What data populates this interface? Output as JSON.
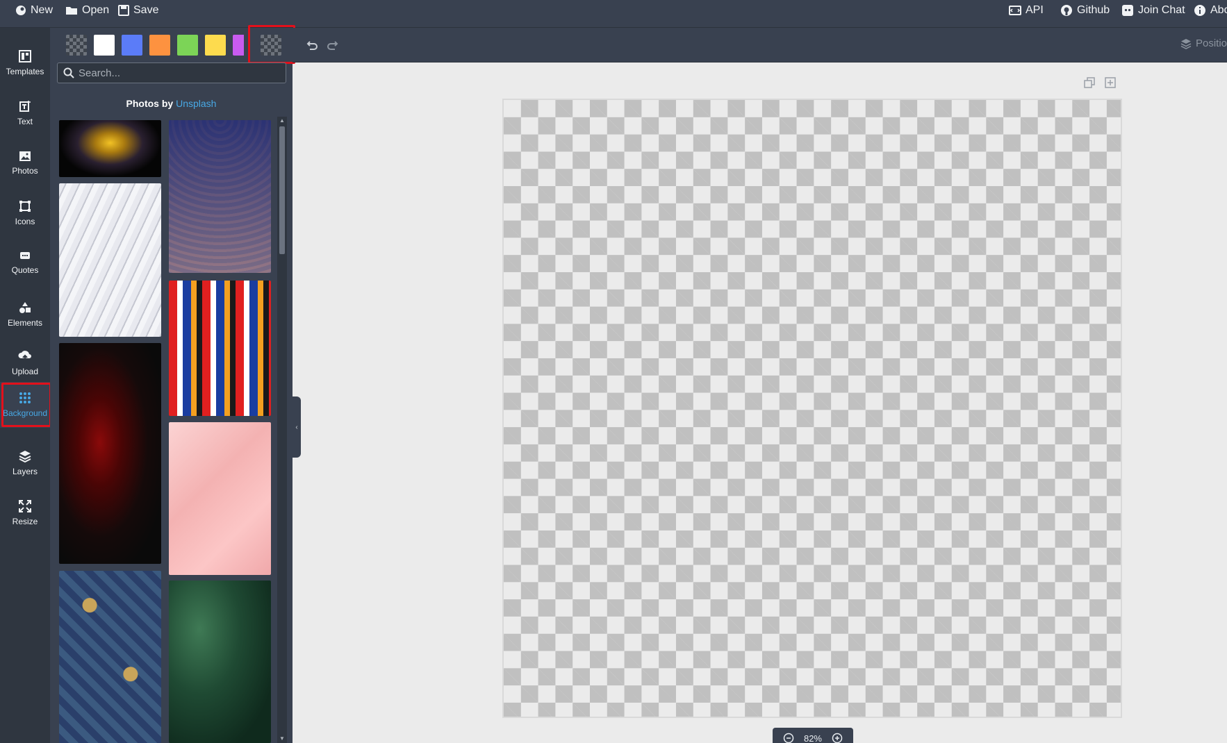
{
  "topbar": {
    "new_label": "New",
    "open_label": "Open",
    "save_label": "Save",
    "api_label": "API",
    "github_label": "Github",
    "join_chat_label": "Join Chat",
    "about_label": "Abo"
  },
  "sidebar": {
    "items": [
      {
        "label": "Templates",
        "icon": "templates-icon"
      },
      {
        "label": "Text",
        "icon": "text-icon"
      },
      {
        "label": "Photos",
        "icon": "photos-icon"
      },
      {
        "label": "Icons",
        "icon": "icons-icon"
      },
      {
        "label": "Quotes",
        "icon": "quotes-icon"
      },
      {
        "label": "Elements",
        "icon": "elements-icon"
      },
      {
        "label": "Upload",
        "icon": "upload-icon"
      },
      {
        "label": "Background",
        "icon": "background-grid-icon",
        "active": true
      },
      {
        "label": "Layers",
        "icon": "layers-icon"
      },
      {
        "label": "Resize",
        "icon": "resize-icon"
      }
    ]
  },
  "panel": {
    "swatches": [
      {
        "type": "transparent"
      },
      {
        "color": "#ffffff"
      },
      {
        "color": "#5b7cf8"
      },
      {
        "color": "#fd9240"
      },
      {
        "color": "#7cd457"
      },
      {
        "color": "#fddb4e"
      },
      {
        "color": "#c85bf0"
      },
      {
        "type": "transparent",
        "selected": true
      }
    ],
    "search_placeholder": "Search...",
    "photos_by_label": "Photos by",
    "unsplash_label": "Unsplash",
    "photos": [
      {
        "description": "dark hand sculpture photo"
      },
      {
        "description": "purple scale pattern photo"
      },
      {
        "description": "white wavy lines photo"
      },
      {
        "description": "colorful bricks pattern photo"
      },
      {
        "description": "red fractal on black photo"
      },
      {
        "description": "pink marble texture photo"
      },
      {
        "description": "birds floral pattern photo"
      },
      {
        "description": "green leaves photo"
      }
    ]
  },
  "toolbar": {
    "undo_icon": "undo-icon",
    "redo_icon": "redo-icon",
    "position_label": "Positio"
  },
  "canvas": {
    "background": "transparent",
    "zoom_label": "82%"
  },
  "colors": {
    "accent": "#48a9e6",
    "highlight": "#e3101b",
    "dark": "#394150",
    "darker": "#2f3640"
  }
}
